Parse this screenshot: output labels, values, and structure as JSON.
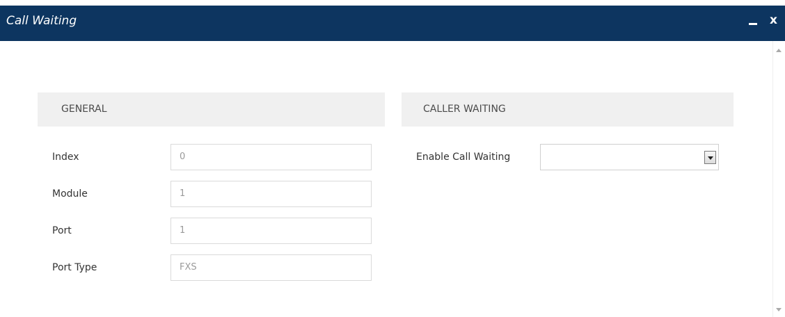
{
  "window": {
    "title": "Call Waiting",
    "minimize_icon": "minimize-icon",
    "close_label": "x"
  },
  "general": {
    "header": "GENERAL",
    "fields": [
      {
        "label": "Index",
        "value": "0"
      },
      {
        "label": "Module",
        "value": "1"
      },
      {
        "label": "Port",
        "value": "1"
      },
      {
        "label": "Port Type",
        "value": "FXS"
      }
    ]
  },
  "caller_waiting": {
    "header": "CALLER WAITING",
    "enable_label": "Enable Call Waiting",
    "enable_value": ""
  },
  "colors": {
    "titlebar": "#0d3560",
    "header_bg": "#f0f0f0",
    "input_text": "#9a9a9a"
  }
}
